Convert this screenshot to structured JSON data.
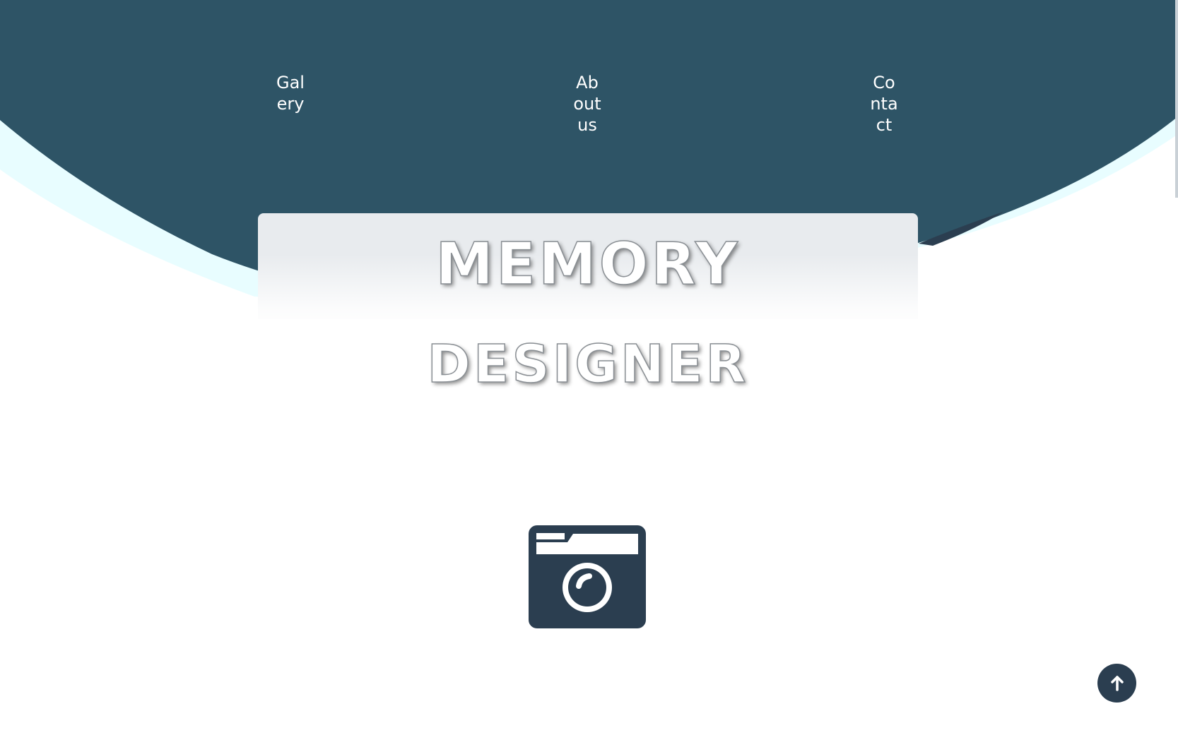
{
  "nav": {
    "items": [
      {
        "label": "Galery"
      },
      {
        "label": "About us"
      },
      {
        "label": "Contact"
      }
    ]
  },
  "hero": {
    "title_line_1": "MEMORY",
    "title_line_2": "DESIGNER"
  },
  "icons": {
    "camera": "camera-icon",
    "scroll_top": "arrow-up-icon"
  },
  "colors": {
    "header_dark": "#2e5466",
    "accent_light": "#e8fdff",
    "card": "#e8ebee",
    "icon_dark": "#2b3e50",
    "background": "#ffffff"
  }
}
